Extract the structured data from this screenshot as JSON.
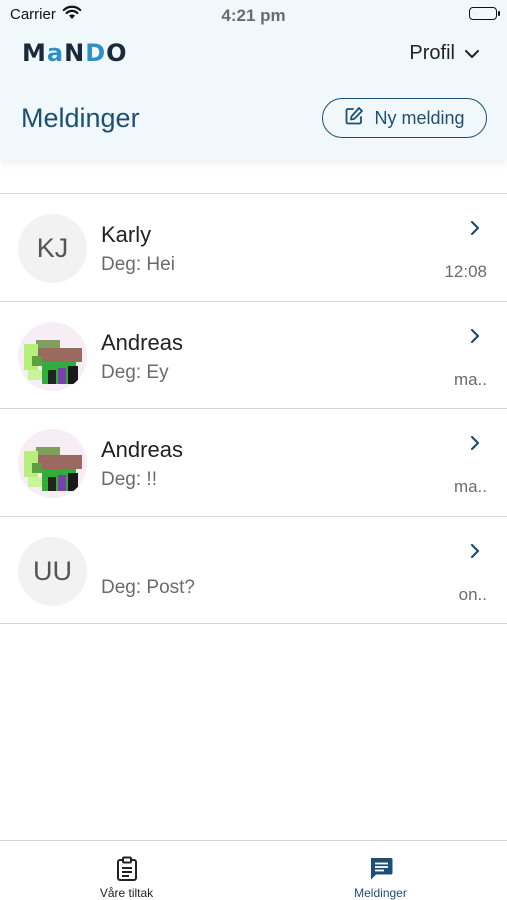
{
  "status_bar": {
    "carrier": "Carrier",
    "time": "4:21 pm"
  },
  "header": {
    "logo_parts": [
      "M",
      "a",
      "N",
      "D",
      "O"
    ],
    "profile_label": "Profil",
    "title": "Meldinger",
    "new_message_label": "Ny melding"
  },
  "conversations": [
    {
      "initials": "KJ",
      "avatar": "initials",
      "name": "Karly",
      "preview": "Deg: Hei",
      "time": "12:08"
    },
    {
      "initials": "",
      "avatar": "photo",
      "name": "Andreas",
      "preview": "Deg: Ey",
      "time": "ma.."
    },
    {
      "initials": "",
      "avatar": "photo",
      "name": "Andreas",
      "preview": "Deg: !!",
      "time": "ma.."
    },
    {
      "initials": "UU",
      "avatar": "initials",
      "name": "",
      "preview": "Deg: Post?",
      "time": "on.."
    }
  ],
  "tab_bar": {
    "tabs": [
      {
        "label": "Våre tiltak",
        "icon": "clipboard-icon"
      },
      {
        "label": "Meldinger",
        "icon": "chat-icon",
        "active": true
      }
    ]
  },
  "colors": {
    "accent": "#1d4f74",
    "header_bg": "#f1f8fc",
    "logo_accent": "#2f8fc7"
  }
}
